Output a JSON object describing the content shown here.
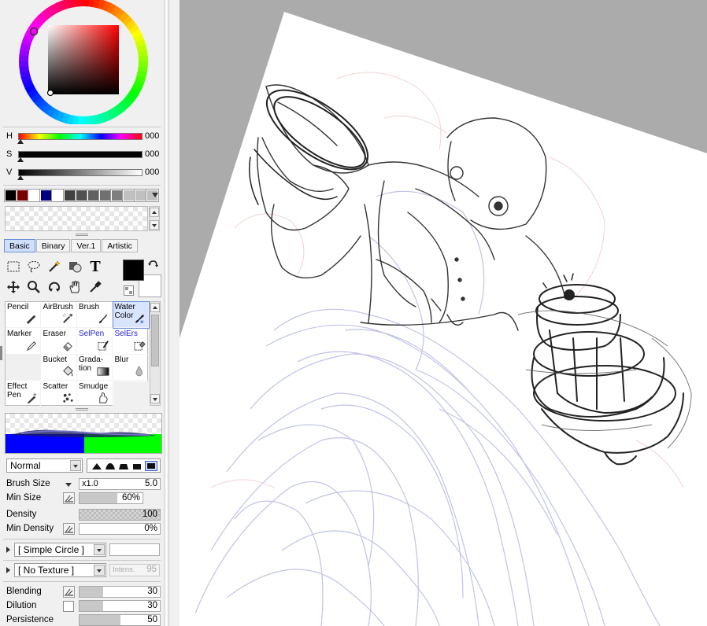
{
  "color_picker": {
    "hsv": [
      {
        "label": "H",
        "value": "000"
      },
      {
        "label": "S",
        "value": "000"
      },
      {
        "label": "V",
        "value": "000"
      }
    ],
    "swatches": [
      "#000000",
      "#7b0000",
      "#ffffff",
      "#000080",
      "#ffffff",
      "#404040",
      "#505050",
      "#606060",
      "#707070",
      "#7f7f7f",
      "#c0c0c0",
      "#c0c0c0",
      "#c0c0c0"
    ]
  },
  "tabs": [
    {
      "label": "Basic",
      "active": true
    },
    {
      "label": "Binary"
    },
    {
      "label": "Ver.1"
    },
    {
      "label": "Artistic"
    }
  ],
  "tool_icons": [
    "rect-select-icon",
    "lasso-icon",
    "magic-wand-icon",
    "select-pen-icon",
    "text-icon",
    "move-icon",
    "zoom-icon",
    "rotate-icon",
    "hand-icon",
    "eyedropper-icon"
  ],
  "text_tool_glyph": "T",
  "colors": {
    "foreground": "#000000",
    "background": "#ffffff",
    "selected": "#6f92d8",
    "tab_active": "#cfe0ff"
  },
  "brushes": [
    {
      "name": "Pencil",
      "icon": "pencil-icon"
    },
    {
      "name": "AirBrush",
      "icon": "airbrush-icon"
    },
    {
      "name": "Brush",
      "icon": "brush-icon"
    },
    {
      "name": "Water\nColor",
      "icon": "watercolor-icon",
      "selected": true
    },
    {
      "name": "Marker",
      "icon": "marker-icon"
    },
    {
      "name": "Eraser",
      "icon": "eraser-icon"
    },
    {
      "name": "SelPen",
      "icon": "selpen-icon",
      "blue": true
    },
    {
      "name": "SelErs",
      "icon": "selers-icon",
      "blue": true
    },
    {
      "name": "",
      "icon": "",
      "empty": true
    },
    {
      "name": "Bucket",
      "icon": "bucket-icon"
    },
    {
      "name": "Grada-\ntion",
      "icon": "gradation-icon"
    },
    {
      "name": "Blur",
      "icon": "blur-icon"
    },
    {
      "name": "Effect\nPen",
      "icon": "effect-pen-icon"
    },
    {
      "name": "Scatter",
      "icon": "scatter-icon"
    },
    {
      "name": "Smudge",
      "icon": "smudge-icon"
    },
    {
      "name": "",
      "icon": "",
      "empty": true
    }
  ],
  "blend_mode": "Normal",
  "brush_size": {
    "label": "Brush Size",
    "multiplier": "x1.0",
    "value": "5.0"
  },
  "min_size": {
    "label": "Min Size",
    "value": "60%",
    "fraction": 0.6
  },
  "density": {
    "label": "Density",
    "value": "100"
  },
  "min_density": {
    "label": "Min Density",
    "value": "0%"
  },
  "brush_shape": "[ Simple Circle ]",
  "texture": "[ No Texture ]",
  "texture_intensity": {
    "label": "Intens.",
    "value": "95"
  },
  "blending": {
    "label": "Blending",
    "value": "30"
  },
  "dilution": {
    "label": "Dilution",
    "value": "30"
  },
  "persistence": {
    "label": "Persistence",
    "value": "50"
  }
}
